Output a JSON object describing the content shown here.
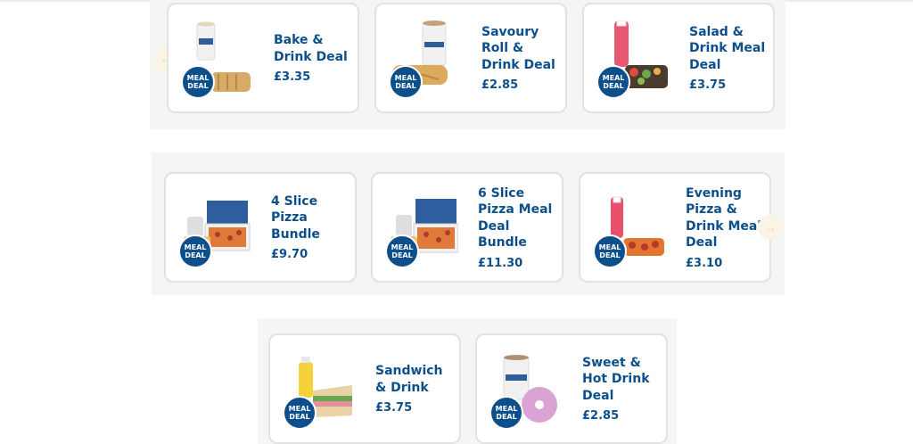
{
  "badge_label": "MEAL DEAL",
  "nav": {
    "prev_arrow": "←",
    "next_arrow": "→"
  },
  "colors": {
    "brand_blue": "#0d4f8b",
    "band_bg": "#f5f5f5"
  },
  "rows": [
    [
      {
        "title": "Bake & Drink Deal",
        "price": "£3.35",
        "icon": "bake-drink-image"
      },
      {
        "title": "Savoury Roll & Drink Deal",
        "price": "£2.85",
        "icon": "savoury-roll-drink-image"
      },
      {
        "title": "Salad & Drink Meal Deal",
        "price": "£3.75",
        "icon": "salad-drink-image"
      }
    ],
    [
      {
        "title": "4 Slice Pizza Bundle",
        "price": "£9.70",
        "icon": "pizza-bundle-image"
      },
      {
        "title": "6 Slice Pizza Meal Deal Bundle",
        "price": "£11.30",
        "icon": "pizza-meal-bundle-image"
      },
      {
        "title": "Evening Pizza & Drink Meal Deal",
        "price": "£3.10",
        "icon": "evening-pizza-drink-image"
      }
    ],
    [
      {
        "title": "Sandwich & Drink",
        "price": "£3.75",
        "icon": "sandwich-drink-image"
      },
      {
        "title": "Sweet & Hot Drink Deal",
        "price": "£2.85",
        "icon": "sweet-hot-drink-image"
      }
    ]
  ]
}
